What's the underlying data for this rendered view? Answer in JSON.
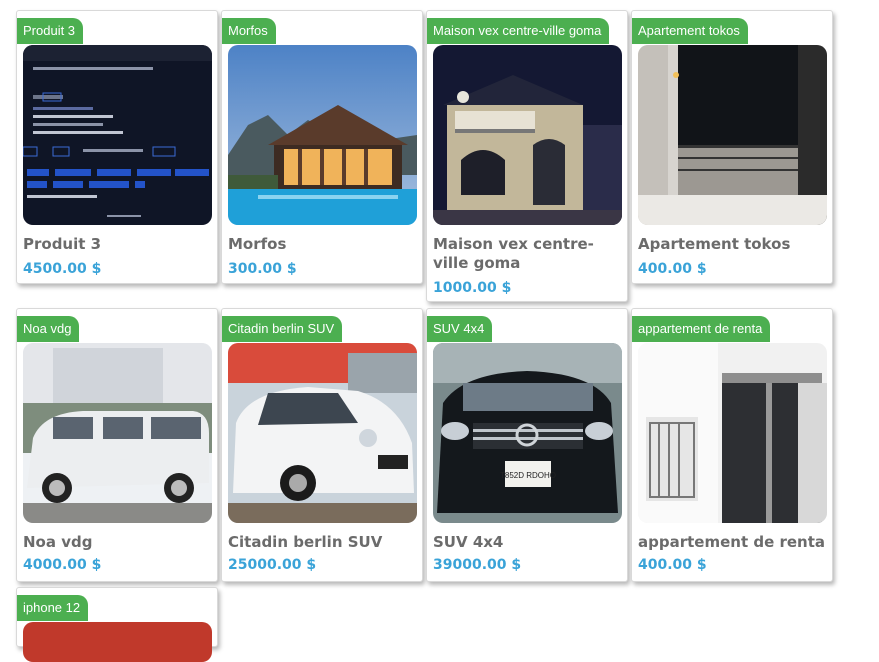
{
  "currency": "$",
  "products": [
    {
      "badge": "Produit 3",
      "name": "Produit 3",
      "price": "4500.00 $",
      "image": "code-editor-screenshot"
    },
    {
      "badge": "Morfos",
      "name": "Morfos",
      "price": "300.00 $",
      "image": "villa-with-pool"
    },
    {
      "badge": "Maison vex centre-ville goma",
      "name": "Maison vex centre-ville goma",
      "price": "1000.00 $",
      "image": "house-at-night"
    },
    {
      "badge": "Apartement tokos",
      "name": "Apartement tokos",
      "price": "400.00 $",
      "image": "apartment-balcony"
    },
    {
      "badge": "Noa vdg",
      "name": "Noa vdg",
      "price": "4000.00 $",
      "image": "white-minivan"
    },
    {
      "badge": "Citadin berlin SUV",
      "name": "Citadin berlin SUV",
      "price": "25000.00 $",
      "image": "white-compact-suv"
    },
    {
      "badge": "SUV 4x4",
      "name": "SUV 4x4",
      "price": "39000.00 $",
      "image": "black-suv-front",
      "plate": "T852D RDOHO"
    },
    {
      "badge": "appartement de renta",
      "name": "appartement de renta",
      "price": "400.00 $",
      "image": "rental-apartment-window"
    },
    {
      "badge": "iphone 12",
      "name": "",
      "price": "",
      "image": "phone"
    }
  ]
}
